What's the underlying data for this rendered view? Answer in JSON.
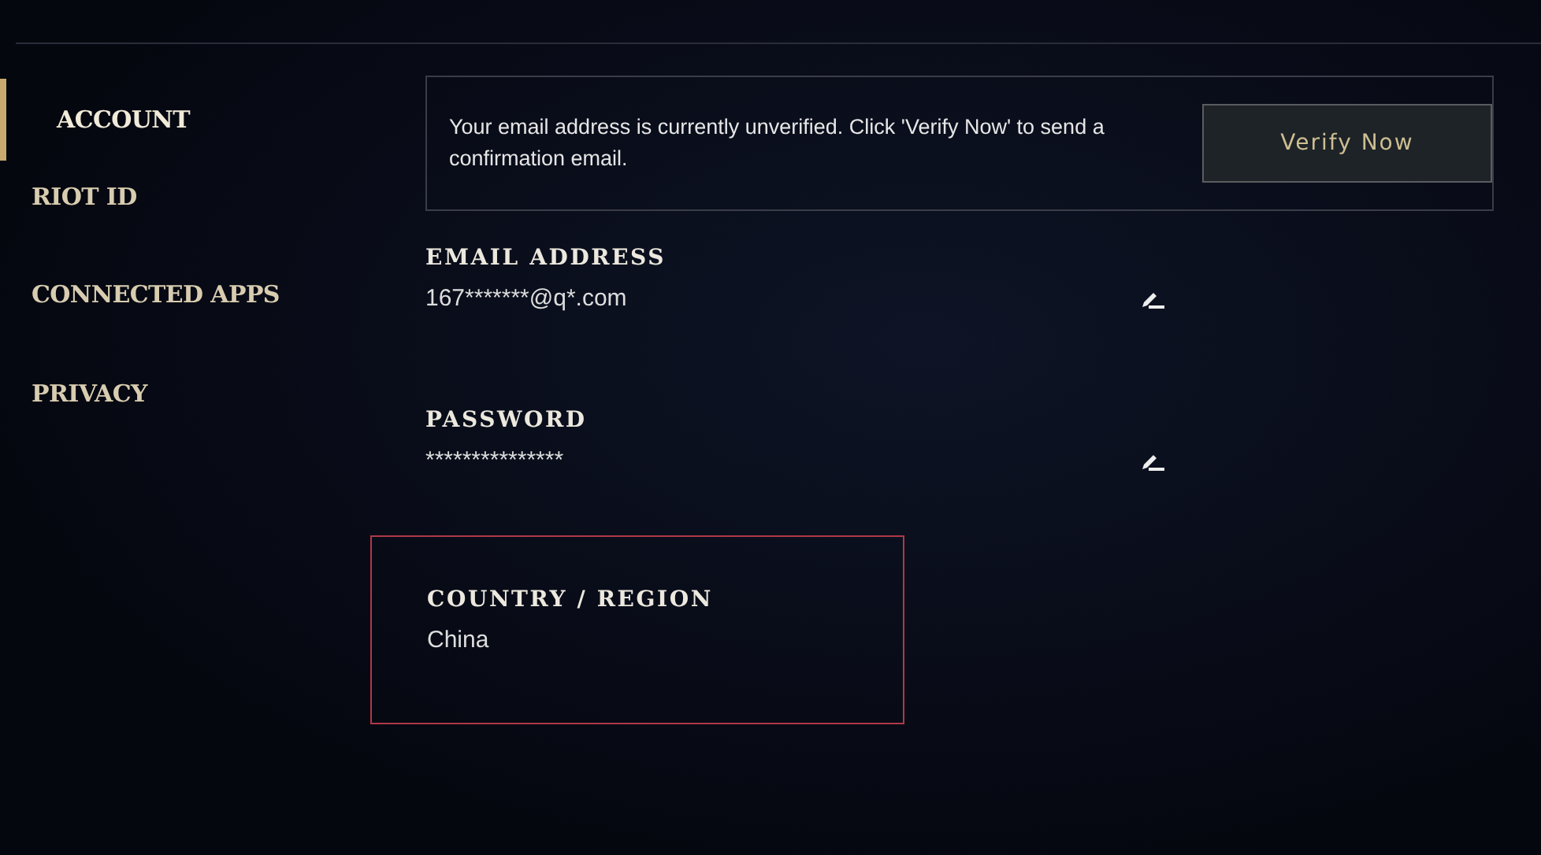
{
  "sidebar": {
    "items": [
      {
        "label": "ACCOUNT",
        "selected": true
      },
      {
        "label": "RIOT ID",
        "selected": false
      },
      {
        "label": "CONNECTED APPS",
        "selected": false
      },
      {
        "label": "PRIVACY",
        "selected": false
      }
    ]
  },
  "banner": {
    "message": "Your email address is currently unverified. Click 'Verify Now' to send a confirmation email.",
    "button": "Verify Now"
  },
  "fields": [
    {
      "label": "EMAIL ADDRESS",
      "value": "167*******@q*.com",
      "editable": true,
      "highlighted": false
    },
    {
      "label": "PASSWORD",
      "value": "***************",
      "editable": true,
      "highlighted": false
    },
    {
      "label": "COUNTRY / REGION",
      "value": "China",
      "editable": false,
      "highlighted": true
    }
  ]
}
